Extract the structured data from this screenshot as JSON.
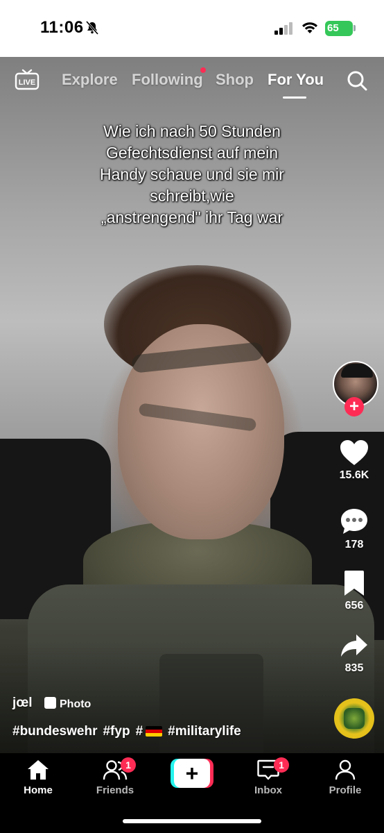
{
  "status_bar": {
    "time": "11:06",
    "battery": "65"
  },
  "top_nav": {
    "live_label": "LIVE",
    "tabs": [
      "Explore",
      "Following",
      "Shop",
      "For You"
    ],
    "active_tab": "For You"
  },
  "caption": {
    "lines": [
      "Wie ich nach 50 Stunden",
      "Gefechtsdienst auf mein",
      "Handy schaue und sie mir",
      "schreibt,wie",
      "„anstrengend\" ihr Tag war"
    ]
  },
  "actions": {
    "likes": "15.6K",
    "comments": "178",
    "saves": "656",
    "shares": "835"
  },
  "post": {
    "author": "jœl",
    "type_badge": "Photo",
    "hashtags": [
      "#bundeswehr",
      "#fyp",
      "#",
      "#militarylife"
    ]
  },
  "tab_bar": {
    "items": [
      {
        "label": "Home",
        "icon": "home-icon"
      },
      {
        "label": "Friends",
        "icon": "friends-icon",
        "badge": "1"
      },
      {
        "label": "",
        "icon": "plus-icon"
      },
      {
        "label": "Inbox",
        "icon": "inbox-icon",
        "badge": "1"
      },
      {
        "label": "Profile",
        "icon": "profile-icon"
      }
    ],
    "active": "Home"
  },
  "colors": {
    "accent": "#fe2c55",
    "cyan": "#25f4ee",
    "battery": "#35c759"
  }
}
